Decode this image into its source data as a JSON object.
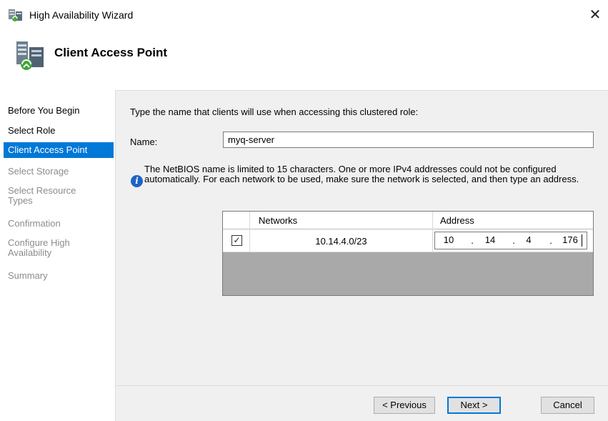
{
  "window": {
    "title": "High Availability Wizard",
    "close_glyph": "✕"
  },
  "header": {
    "title": "Client Access Point"
  },
  "nav": {
    "items": [
      {
        "label": "Before You Begin",
        "state": "done"
      },
      {
        "label": "Select Role",
        "state": "done"
      },
      {
        "label": "Client Access Point",
        "state": "selected"
      },
      {
        "label": "Select Storage",
        "state": "disabled"
      },
      {
        "label": "Select Resource\nTypes",
        "state": "disabled"
      },
      {
        "label": "Confirmation",
        "state": "disabled"
      },
      {
        "label": "Configure High\nAvailability",
        "state": "disabled"
      },
      {
        "label": "Summary",
        "state": "disabled"
      }
    ]
  },
  "form": {
    "instruction": "Type the name that clients will use when accessing this clustered role:",
    "name_label": "Name:",
    "name_value": "myq-server",
    "info_text": "The NetBIOS name is limited to 15 characters.  One or more IPv4 addresses could not be configured automatically.  For each network to be used, make sure the network is selected, and then type an address."
  },
  "grid": {
    "columns": [
      "Networks",
      "Address"
    ],
    "rows": [
      {
        "checked": true,
        "check_glyph": "✓",
        "network": "10.14.4.0/23",
        "address": [
          "10",
          "14",
          "4",
          "176"
        ]
      }
    ]
  },
  "buttons": {
    "previous": "< Previous",
    "next": "Next >",
    "cancel": "Cancel"
  },
  "colors": {
    "selection": "#0078d7",
    "disabled_text": "#8c8c8c",
    "info_icon": "#1e63c6",
    "grid_empty": "#a9a9a9",
    "panel": "#f0f0f0"
  }
}
